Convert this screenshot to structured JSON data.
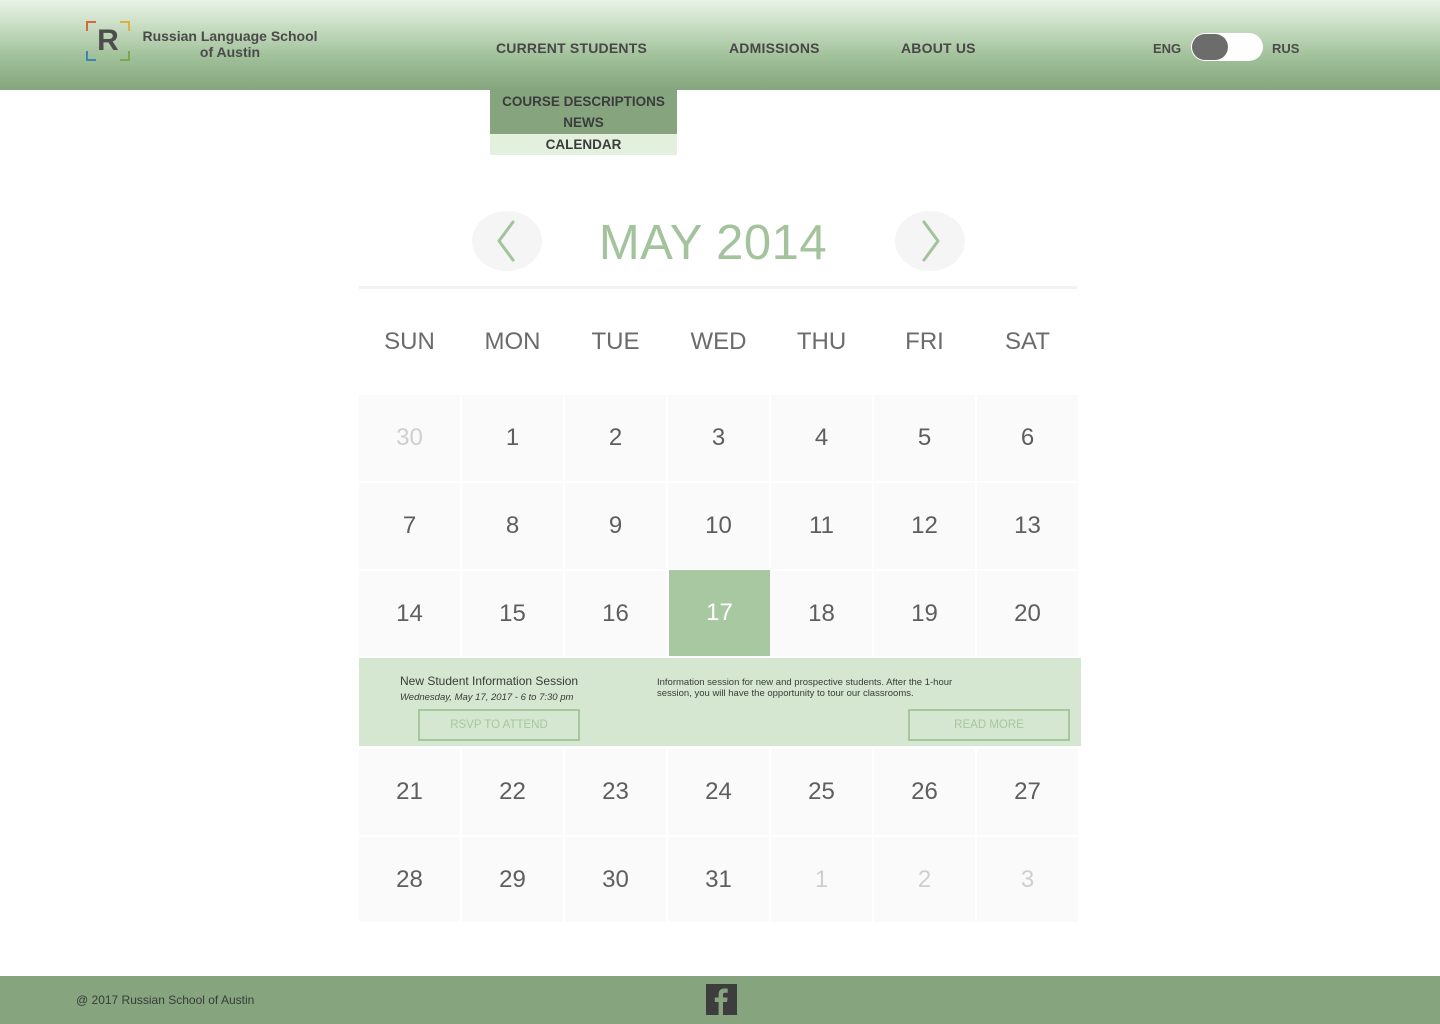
{
  "header": {
    "logo_letter": "R",
    "school_name_line1": "Russian Language School",
    "school_name_line2": "of Austin",
    "nav": {
      "current_students": "CURRENT STUDENTS",
      "admissions": "ADMISSIONS",
      "about_us": "ABOUT US"
    },
    "language": {
      "left": "ENG",
      "right": "RUS",
      "selected": "ENG"
    }
  },
  "dropdown": {
    "items": [
      "COURSE DESCRIPTIONS",
      "NEWS",
      "CALENDAR"
    ],
    "active": "CALENDAR"
  },
  "calendar": {
    "month_title": "MAY 2014",
    "weekdays": [
      "SUN",
      "MON",
      "TUE",
      "WED",
      "THU",
      "FRI",
      "SAT"
    ],
    "weeks": [
      [
        "30",
        "1",
        "2",
        "3",
        "4",
        "5",
        "6"
      ],
      [
        "7",
        "8",
        "9",
        "10",
        "11",
        "12",
        "13"
      ],
      [
        "14",
        "15",
        "16",
        "17",
        "18",
        "19",
        "20"
      ],
      [
        "21",
        "22",
        "23",
        "24",
        "25",
        "26",
        "27"
      ],
      [
        "28",
        "29",
        "30",
        "31",
        "1",
        "2",
        "3"
      ]
    ],
    "selected_day": "17"
  },
  "event": {
    "title": "New Student Information Session",
    "date": "Wednesday, May 17, 2017 - 6 to 7:30 pm",
    "description": "Information session for new and prospective students. After the 1-hour session, you will have the opportunity to tour our classrooms.",
    "rsvp_label": "RSVP TO ATTEND",
    "read_more_label": "READ MORE"
  },
  "footer": {
    "copyright": "@ 2017 Russian School of Austin",
    "social_icon": "facebook-icon"
  },
  "colors": {
    "accent": "#a3c39c",
    "header_green": "#86a57f",
    "event_bg": "#d5e7d0",
    "selected_day_bg": "#a8c8a1"
  }
}
